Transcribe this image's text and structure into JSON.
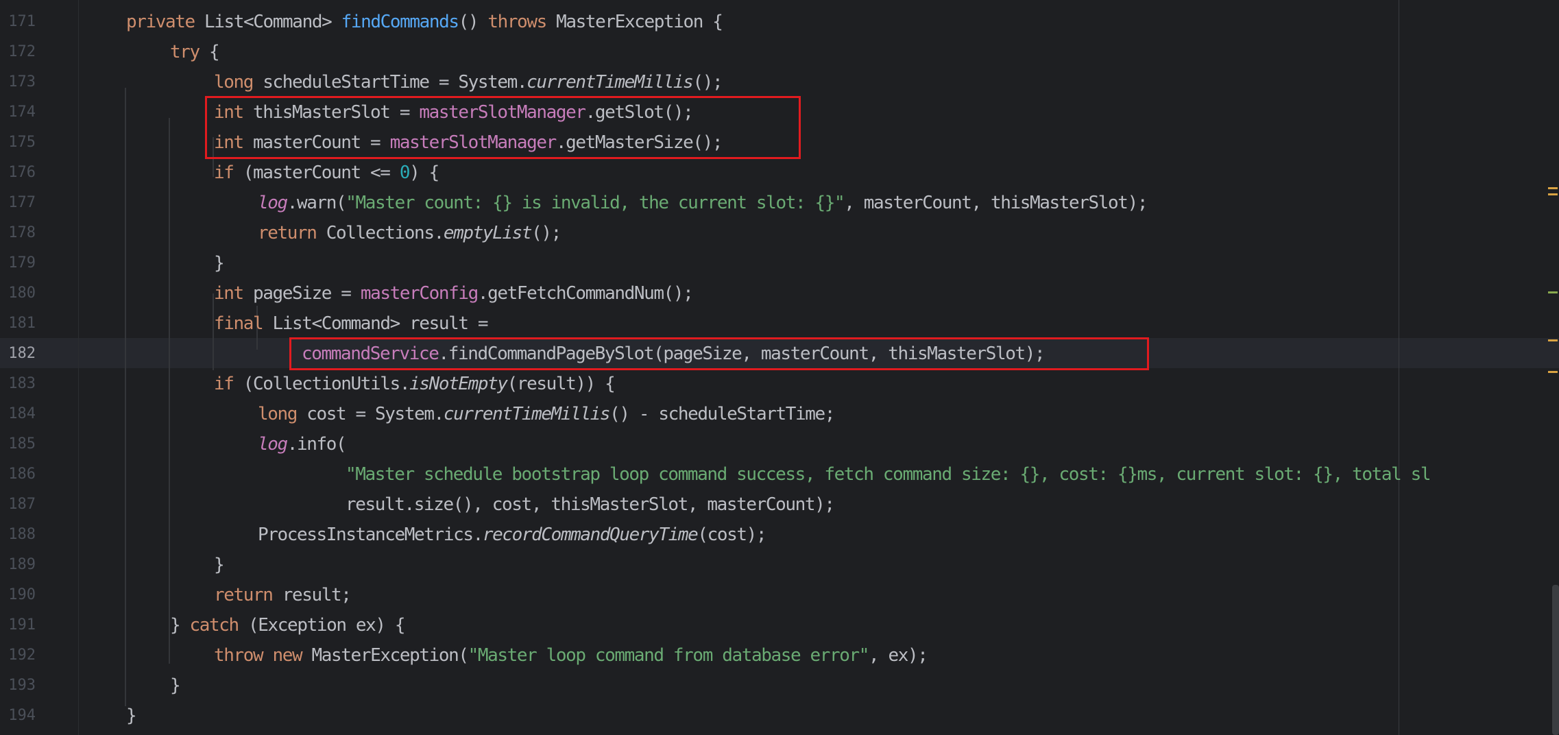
{
  "editor": {
    "active_line": "182",
    "lines": [
      {
        "num": "171",
        "indent": 1,
        "tokens": [
          {
            "t": "private ",
            "c": "kw"
          },
          {
            "t": "List<Command> ",
            "c": ""
          },
          {
            "t": "findCommands",
            "c": "fn"
          },
          {
            "t": "() ",
            "c": ""
          },
          {
            "t": "throws ",
            "c": "kw"
          },
          {
            "t": "MasterException {",
            "c": ""
          }
        ]
      },
      {
        "num": "172",
        "indent": 2,
        "tokens": [
          {
            "t": "try ",
            "c": "kw"
          },
          {
            "t": "{",
            "c": ""
          }
        ]
      },
      {
        "num": "173",
        "indent": 3,
        "tokens": [
          {
            "t": "long ",
            "c": "kw"
          },
          {
            "t": "scheduleStartTime = System.",
            "c": ""
          },
          {
            "t": "currentTimeMillis",
            "c": "it"
          },
          {
            "t": "();",
            "c": ""
          }
        ]
      },
      {
        "num": "174",
        "indent": 3,
        "tokens": [
          {
            "t": "int ",
            "c": "kw"
          },
          {
            "t": "thisMasterSlot = ",
            "c": ""
          },
          {
            "t": "masterSlotManager",
            "c": "fld"
          },
          {
            "t": ".getSlot();",
            "c": ""
          }
        ]
      },
      {
        "num": "175",
        "indent": 3,
        "tokens": [
          {
            "t": "int ",
            "c": "kw"
          },
          {
            "t": "masterCount = ",
            "c": ""
          },
          {
            "t": "masterSlotManager",
            "c": "fld"
          },
          {
            "t": ".getMasterSize();",
            "c": ""
          }
        ]
      },
      {
        "num": "176",
        "indent": 3,
        "tokens": [
          {
            "t": "if ",
            "c": "kw"
          },
          {
            "t": "(masterCount <= ",
            "c": ""
          },
          {
            "t": "0",
            "c": "num"
          },
          {
            "t": ") {",
            "c": ""
          }
        ]
      },
      {
        "num": "177",
        "indent": 4,
        "tokens": [
          {
            "t": "log",
            "c": "fld it"
          },
          {
            "t": ".warn(",
            "c": ""
          },
          {
            "t": "\"Master count: {} is invalid, the current slot: {}\"",
            "c": "str"
          },
          {
            "t": ", masterCount, thisMasterSlot);",
            "c": ""
          }
        ]
      },
      {
        "num": "178",
        "indent": 4,
        "tokens": [
          {
            "t": "return ",
            "c": "kw"
          },
          {
            "t": "Collections.",
            "c": ""
          },
          {
            "t": "emptyList",
            "c": "it"
          },
          {
            "t": "();",
            "c": ""
          }
        ]
      },
      {
        "num": "179",
        "indent": 3,
        "tokens": [
          {
            "t": "}",
            "c": ""
          }
        ]
      },
      {
        "num": "180",
        "indent": 3,
        "tokens": [
          {
            "t": "int ",
            "c": "kw"
          },
          {
            "t": "pageSize = ",
            "c": ""
          },
          {
            "t": "masterConfig",
            "c": "fld"
          },
          {
            "t": ".getFetchCommandNum();",
            "c": ""
          }
        ]
      },
      {
        "num": "181",
        "indent": 3,
        "tokens": [
          {
            "t": "final ",
            "c": "kw"
          },
          {
            "t": "List<Command> result =",
            "c": ""
          }
        ]
      },
      {
        "num": "182",
        "indent": 5,
        "tokens": [
          {
            "t": "commandService",
            "c": "fld"
          },
          {
            "t": ".findCommandPageBySlot(pageSize, masterCount, thisMasterSlot);",
            "c": ""
          }
        ]
      },
      {
        "num": "183",
        "indent": 3,
        "tokens": [
          {
            "t": "if ",
            "c": "kw"
          },
          {
            "t": "(CollectionUtils.",
            "c": ""
          },
          {
            "t": "isNotEmpty",
            "c": "it"
          },
          {
            "t": "(result)) {",
            "c": ""
          }
        ]
      },
      {
        "num": "184",
        "indent": 4,
        "tokens": [
          {
            "t": "long ",
            "c": "kw"
          },
          {
            "t": "cost = System.",
            "c": ""
          },
          {
            "t": "currentTimeMillis",
            "c": "it"
          },
          {
            "t": "() - scheduleStartTime;",
            "c": ""
          }
        ]
      },
      {
        "num": "185",
        "indent": 4,
        "tokens": [
          {
            "t": "log",
            "c": "fld it"
          },
          {
            "t": ".info(",
            "c": ""
          }
        ]
      },
      {
        "num": "186",
        "indent": 6,
        "tokens": [
          {
            "t": "\"Master schedule bootstrap loop command success, fetch command size: {}, cost: {}ms, current slot: {}, total sl",
            "c": "str"
          }
        ]
      },
      {
        "num": "187",
        "indent": 6,
        "tokens": [
          {
            "t": "result.size(), cost, thisMasterSlot, masterCount);",
            "c": ""
          }
        ]
      },
      {
        "num": "188",
        "indent": 4,
        "tokens": [
          {
            "t": "ProcessInstanceMetrics.",
            "c": ""
          },
          {
            "t": "recordCommandQueryTime",
            "c": "it"
          },
          {
            "t": "(cost);",
            "c": ""
          }
        ]
      },
      {
        "num": "189",
        "indent": 3,
        "tokens": [
          {
            "t": "}",
            "c": ""
          }
        ]
      },
      {
        "num": "190",
        "indent": 3,
        "tokens": [
          {
            "t": "return ",
            "c": "kw"
          },
          {
            "t": "result;",
            "c": ""
          }
        ]
      },
      {
        "num": "191",
        "indent": 2,
        "tokens": [
          {
            "t": "} ",
            "c": ""
          },
          {
            "t": "catch ",
            "c": "kw"
          },
          {
            "t": "(Exception ex) {",
            "c": ""
          }
        ]
      },
      {
        "num": "192",
        "indent": 3,
        "tokens": [
          {
            "t": "throw new ",
            "c": "kw"
          },
          {
            "t": "MasterException(",
            "c": ""
          },
          {
            "t": "\"Master loop command from database error\"",
            "c": "str"
          },
          {
            "t": ", ex);",
            "c": ""
          }
        ]
      },
      {
        "num": "193",
        "indent": 2,
        "tokens": [
          {
            "t": "}",
            "c": ""
          }
        ]
      },
      {
        "num": "194",
        "indent": 1,
        "tokens": [
          {
            "t": "}",
            "c": ""
          }
        ]
      }
    ],
    "highlights": [
      {
        "label": "slot-and-count-assignments",
        "from": "174",
        "to": "175"
      },
      {
        "label": "find-command-page-by-slot-call",
        "from": "182",
        "to": "182"
      }
    ],
    "marker_colors": [
      "#d9a343",
      "#d9a343",
      "#89a94f",
      "#d9a343",
      "#d9a343"
    ]
  }
}
